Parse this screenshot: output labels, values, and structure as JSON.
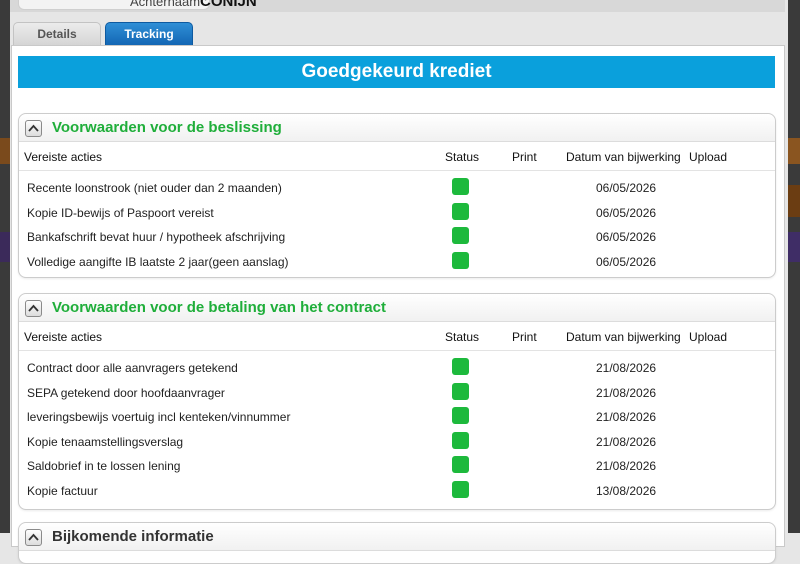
{
  "header": {
    "surname_label": "Achternaam :",
    "surname_value": "CONIJN"
  },
  "tabs": [
    {
      "label": "Details",
      "active": false
    },
    {
      "label": "Tracking",
      "active": true
    }
  ],
  "banner": {
    "title": "Goedgekeurd krediet",
    "color": "#0aa0dc"
  },
  "columns": {
    "actions": "Vereiste acties",
    "status": "Status",
    "print": "Print",
    "date": "Datum van bijwerking",
    "upload": "Upload"
  },
  "sections": [
    {
      "title": "Voorwaarden voor de beslissing",
      "rows": [
        {
          "action": "Recente loonstrook (niet ouder dan 2 maanden)",
          "status": "green",
          "date": "06/05/2026"
        },
        {
          "action": "Kopie ID-bewijs of Paspoort vereist",
          "status": "green",
          "date": "06/05/2026"
        },
        {
          "action": "Bankafschrift bevat huur / hypotheek afschrijving",
          "status": "green",
          "date": "06/05/2026"
        },
        {
          "action": "Volledige aangifte IB laatste 2 jaar(geen aanslag)",
          "status": "green",
          "date": "06/05/2026"
        }
      ]
    },
    {
      "title": "Voorwaarden voor de betaling van het contract",
      "rows": [
        {
          "action": "Contract door alle aanvragers getekend",
          "status": "green",
          "date": "21/08/2026"
        },
        {
          "action": "SEPA getekend door hoofdaanvrager",
          "status": "green",
          "date": "21/08/2026"
        },
        {
          "action": "leveringsbewijs voertuig incl kenteken/vinnummer",
          "status": "green",
          "date": "21/08/2026"
        },
        {
          "action": "Kopie tenaamstellingsverslag",
          "status": "green",
          "date": "21/08/2026"
        },
        {
          "action": "Saldobrief in te lossen lening",
          "status": "green",
          "date": "21/08/2026"
        },
        {
          "action": "Kopie factuur",
          "status": "green",
          "date": "13/08/2026"
        }
      ]
    },
    {
      "title": "Bijkomende informatie"
    }
  ],
  "colors": {
    "accent_green": "#1fae3a",
    "status_green": "#1db93c",
    "tab_active": "#1366b4"
  },
  "icons": {
    "toggle": "chevron-up-icon"
  }
}
